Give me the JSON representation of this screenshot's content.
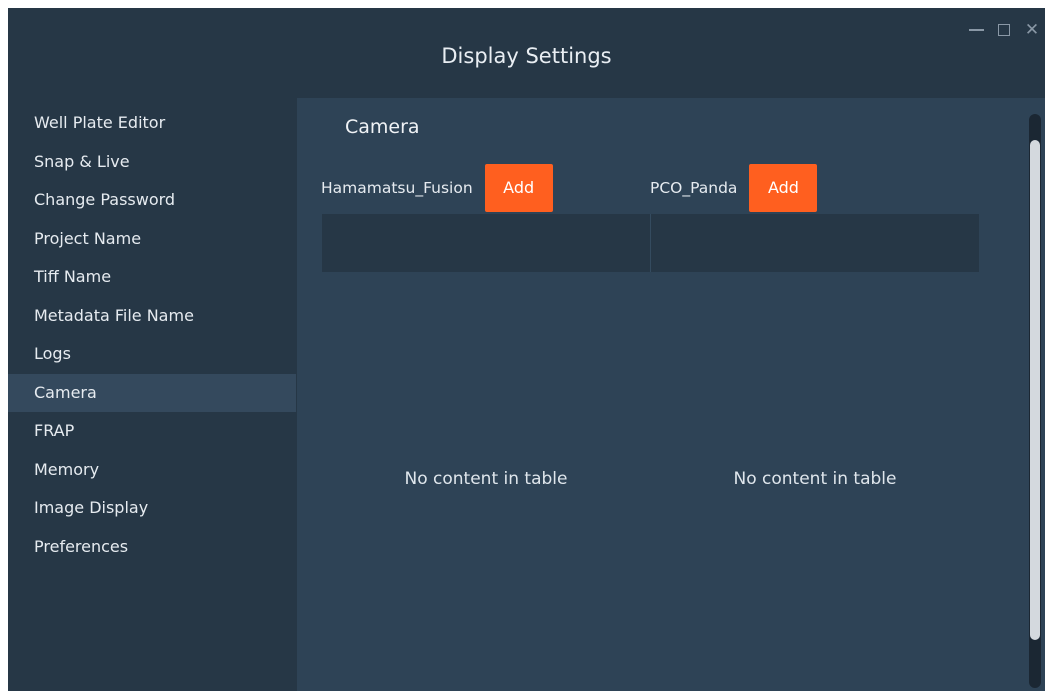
{
  "window": {
    "title": "Display Settings",
    "controls": {
      "minimize": "minimize-icon",
      "maximize": "maximize-icon",
      "close": "close-icon",
      "close_glyph": "✕"
    }
  },
  "sidebar": {
    "items": [
      {
        "label": "Well Plate Editor",
        "active": false
      },
      {
        "label": "Snap & Live",
        "active": false
      },
      {
        "label": "Change Password",
        "active": false
      },
      {
        "label": "Project Name",
        "active": false
      },
      {
        "label": "Tiff Name",
        "active": false
      },
      {
        "label": "Metadata File Name",
        "active": false
      },
      {
        "label": "Logs",
        "active": false
      },
      {
        "label": "Camera",
        "active": true
      },
      {
        "label": "FRAP",
        "active": false
      },
      {
        "label": "Memory",
        "active": false
      },
      {
        "label": "Image Display",
        "active": false
      },
      {
        "label": "Preferences",
        "active": false
      }
    ]
  },
  "main": {
    "section_title": "Camera",
    "cameras": [
      {
        "name": "Hamamatsu_Fusion",
        "add_label": "Add",
        "empty_text": "No content in table"
      },
      {
        "name": "PCO_Panda",
        "add_label": "Add",
        "empty_text": "No content in table"
      }
    ]
  },
  "colors": {
    "background": "#263746",
    "content_panel": "#2e4356",
    "active_item": "#34495d",
    "accent": "#ff5f1f"
  }
}
